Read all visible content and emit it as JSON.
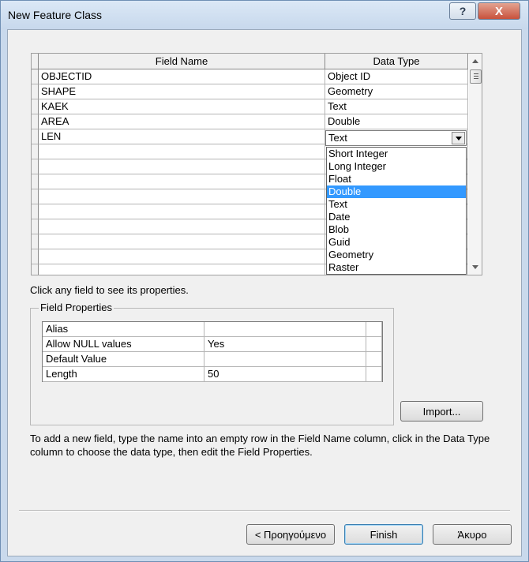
{
  "window": {
    "title": "New Feature Class"
  },
  "grid": {
    "headers": {
      "field_name": "Field Name",
      "data_type": "Data Type"
    },
    "rows": [
      {
        "name": "OBJECTID",
        "type": "Object ID"
      },
      {
        "name": "SHAPE",
        "type": "Geometry"
      },
      {
        "name": "KAEK",
        "type": "Text"
      },
      {
        "name": "AREA",
        "type": "Double"
      },
      {
        "name": "LEN",
        "type": "Text"
      }
    ],
    "combo_value": "Text",
    "dropdown_options": [
      "Short Integer",
      "Long Integer",
      "Float",
      "Double",
      "Text",
      "Date",
      "Blob",
      "Guid",
      "Geometry",
      "Raster"
    ],
    "selected_option": "Double"
  },
  "hint": "Click any field to see its properties.",
  "field_properties": {
    "legend": "Field Properties",
    "rows": [
      {
        "label": "Alias",
        "value": ""
      },
      {
        "label": "Allow NULL values",
        "value": "Yes"
      },
      {
        "label": "Default Value",
        "value": ""
      },
      {
        "label": "Length",
        "value": "50"
      }
    ]
  },
  "buttons": {
    "import": "Import...",
    "back": "< Προηγούμενο",
    "finish": "Finish",
    "cancel": "Άκυρο",
    "help": "?",
    "close": "X"
  },
  "help_text": "To add a new field, type the name into an empty row in the Field Name column, click in the Data Type column to choose the data type, then edit the Field Properties."
}
